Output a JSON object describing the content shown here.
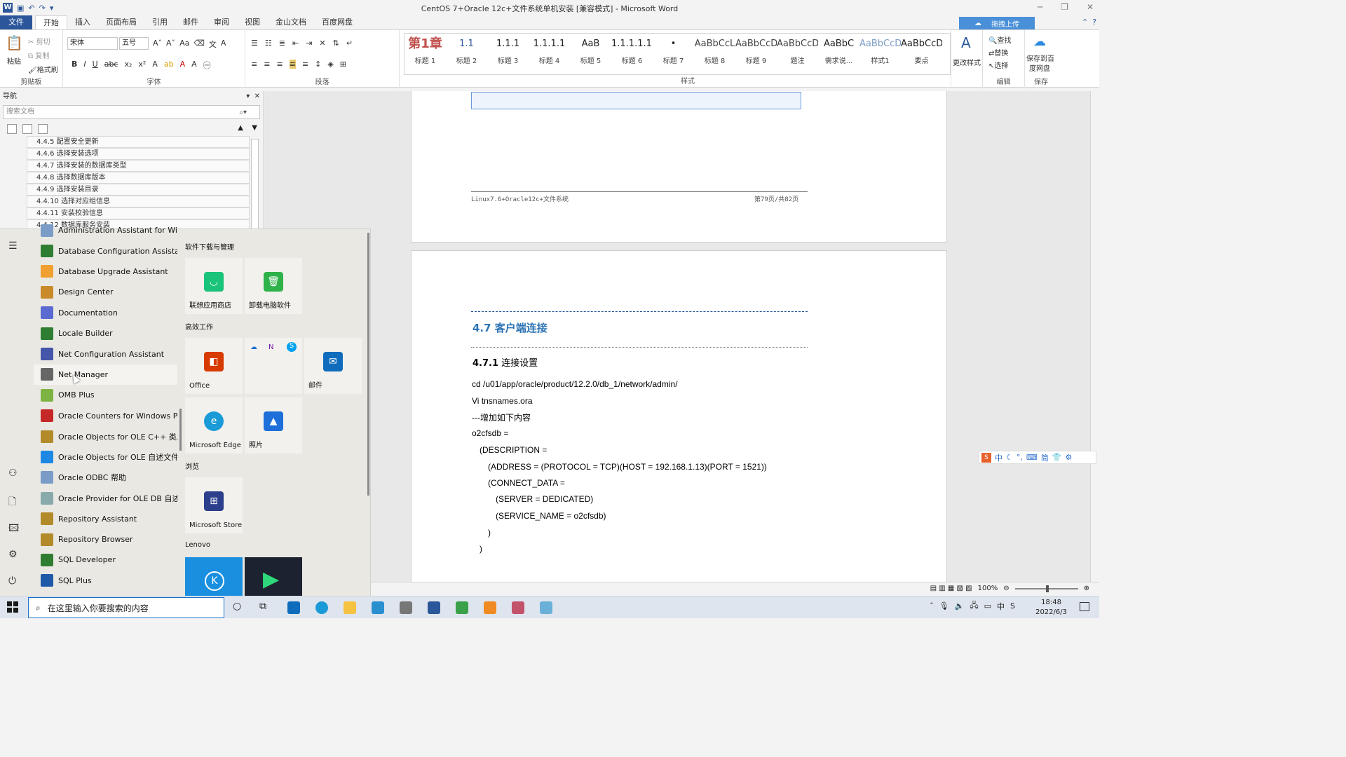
{
  "window": {
    "title": "CentOS 7+Oracle 12c+文件系统单机安装 [兼容模式] - Microsoft Word",
    "upload_label": "拖拽上传"
  },
  "ribbon_tabs": [
    "文件",
    "开始",
    "插入",
    "页面布局",
    "引用",
    "邮件",
    "审阅",
    "视图",
    "金山文档",
    "百度网盘"
  ],
  "clipboard": {
    "paste": "粘贴",
    "cut": "剪切",
    "copy": "复制",
    "format_painter": "格式刷",
    "label": "剪贴板"
  },
  "font": {
    "name": "宋体",
    "size": "五号",
    "label": "字体"
  },
  "paragraph": {
    "label": "段落"
  },
  "styles": {
    "label": "样式",
    "change_styles": "更改样式",
    "items": [
      {
        "preview": "第1章",
        "name": "标题 1"
      },
      {
        "preview": "1.1",
        "name": "标题 2"
      },
      {
        "preview": "1.1.1",
        "name": "标题 3"
      },
      {
        "preview": "1.1.1.1",
        "name": "标题 4"
      },
      {
        "preview": "AaB",
        "name": "标题 5"
      },
      {
        "preview": "1.1.1.1.1.",
        "name": "标题 6"
      },
      {
        "preview": "•",
        "name": "标题 7"
      },
      {
        "preview": "AaBbCcL",
        "name": "标题 8"
      },
      {
        "preview": "AaBbCcD",
        "name": "标题 9"
      },
      {
        "preview": "AaBbCcD",
        "name": "题注"
      },
      {
        "preview": "AaBbC",
        "name": "需求说..."
      },
      {
        "preview": "AaBbCcD",
        "name": "样式1"
      },
      {
        "preview": "AaBbCcD",
        "name": "要点"
      }
    ]
  },
  "editing": {
    "find": "查找",
    "replace": "替换",
    "select": "选择",
    "label": "编辑"
  },
  "save": {
    "label_line1": "保存到百",
    "label_line2": "度网盘",
    "group": "保存"
  },
  "nav": {
    "title": "导航",
    "search_placeholder": "搜索文档",
    "items": [
      "4.4.5 配置安全更新",
      "4.4.6 选择安装选项",
      "4.4.7 选择安装的数据库类型",
      "4.4.8 选择数据库版本",
      "4.4.9 选择安装目录",
      "4.4.10 选择对应组信息",
      "4.4.11 安装校验信息",
      "4.4.12 数据库服务安装"
    ]
  },
  "doc": {
    "footer_left": "Linux7.6+Oracle12c+文件系统",
    "footer_right": "第79页/共82页",
    "h2": "4.7 客户端连接",
    "h3_num": "4.7.1",
    "h3_text": "连接设置",
    "lines": [
      "cd /u01/app/oracle/product/12.2.0/db_1/network/admin/",
      "Vi tnsnames.ora",
      "---增加如下内容",
      "o2cfsdb =",
      "(DESCRIPTION =",
      "(ADDRESS = (PROTOCOL = TCP)(HOST = 192.168.1.13)(PORT = 1521))",
      "(CONNECT_DATA =",
      "(SERVER = DEDICATED)",
      "(SERVICE_NAME = o2cfsdb)",
      ")",
      ")"
    ]
  },
  "status": {
    "zoom": "100%"
  },
  "start_menu": {
    "apps": [
      "Administration Assistant for Win...",
      "Database Configuration Assistant",
      "Database Upgrade Assistant",
      "Design Center",
      "Documentation",
      "Locale Builder",
      "Net Configuration Assistant",
      "Net Manager",
      "OMB Plus",
      "Oracle Counters for Windows Per...",
      "Oracle Objects for OLE C++ 类库...",
      "Oracle Objects for OLE 自述文件",
      "Oracle ODBC 帮助",
      "Oracle Provider for OLE DB 自述...",
      "Repository Assistant",
      "Repository Browser",
      "SQL Developer",
      "SQL Plus"
    ],
    "groups": [
      "软件下载与管理",
      "高效工作",
      "浏览",
      "Lenovo"
    ],
    "tiles": {
      "store": "联想应用商店",
      "uninstall": "卸载电脑软件",
      "office": "Office",
      "mail": "邮件",
      "edge": "Microsoft Edge",
      "photos": "照片",
      "msstore": "Microsoft Store"
    }
  },
  "taskbar": {
    "search_placeholder": "在这里输入你要搜索的内容",
    "time": "18:48",
    "date": "2022/6/3"
  },
  "ime": {
    "mode": "中",
    "simp": "简"
  }
}
